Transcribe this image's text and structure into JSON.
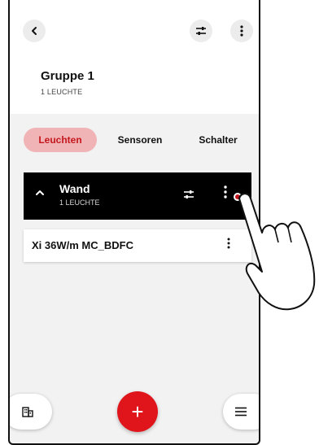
{
  "header": {
    "title": "Gruppe 1",
    "subtitle": "1 LEUCHTE"
  },
  "tabs": [
    {
      "label": "Leuchten",
      "active": true
    },
    {
      "label": "Sensoren",
      "active": false
    },
    {
      "label": "Schalter",
      "active": false
    }
  ],
  "group": {
    "name": "Wand",
    "subtitle": "1 LEUCHTE"
  },
  "lights": [
    {
      "name": "Xi 36W/m MC_BDFC"
    }
  ],
  "fab": {
    "label": "+"
  },
  "colors": {
    "accent": "#e0141b",
    "tab_active_bg": "#f0b4b6",
    "tab_active_text": "#c4161c",
    "group_bar_bg": "#000000"
  },
  "icons": {
    "back": "chevron-left-icon",
    "filter": "sliders-icon",
    "more": "more-vertical-icon",
    "collapse": "chevron-up-icon",
    "rooms": "building-icon",
    "menu": "hamburger-menu-icon",
    "add": "plus-icon",
    "gesture": "tapping-hand-icon"
  }
}
